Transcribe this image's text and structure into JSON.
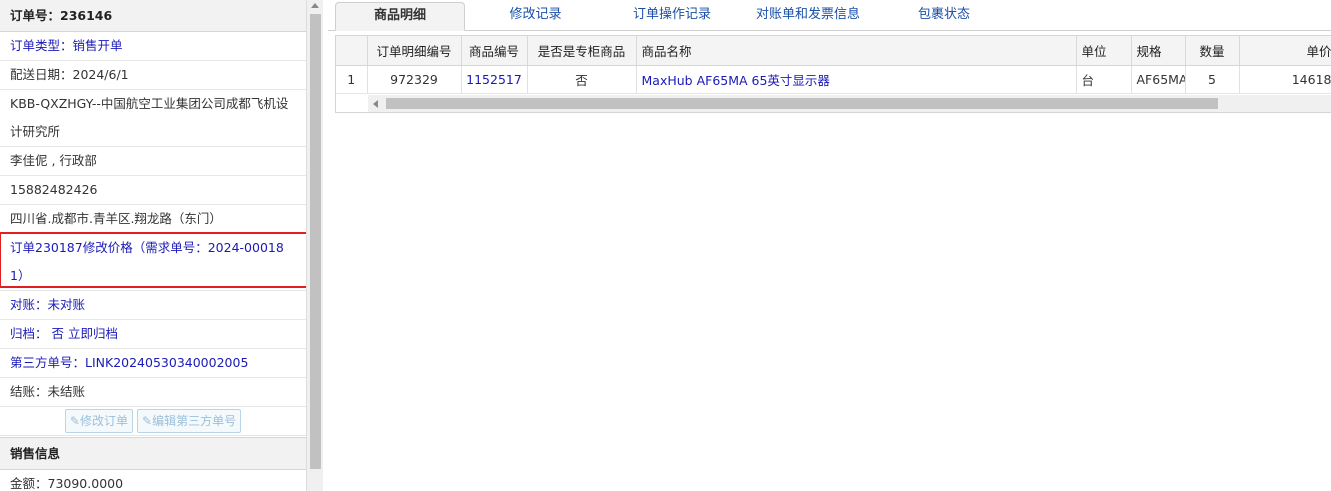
{
  "left": {
    "order_title": "订单号：236146",
    "rows": [
      "订单类型：销售开单",
      "配送日期：2024/6/1",
      "KBB-QXZHGY--中国航空工业集团公司成都飞机设计研究所",
      "李佳伲 , 行政部",
      "15882482426",
      "四川省.成都市.青羊区.翔龙路（东门）",
      "订单230187修改价格（需求单号：2024-000181）",
      "对账：未对账",
      "归档：  否 立即归档",
      "第三方单号：LINK20240530340002005",
      "结账：未结账"
    ],
    "buttons": [
      "修改订单",
      "编辑第三方单号"
    ],
    "sales_title": "销售信息",
    "amount": "金额：73090.0000"
  },
  "tabs": [
    "商品明细",
    "修改记录",
    "订单操作记录",
    "对账单和发票信息",
    "包裹状态"
  ],
  "active_tab": 0,
  "table": {
    "headers": [
      "",
      "订单明细编号",
      "商品编号",
      "是否是专柜商品",
      "商品名称",
      "单位",
      "规格",
      "数量",
      "单价"
    ],
    "rows": [
      [
        "1",
        "972329",
        "1152517",
        "否",
        "MaxHub AF65MA 65英寸显示器",
        "台",
        "AF65MA",
        "5",
        "14618"
      ]
    ]
  },
  "colors": {
    "link": "#1a1ab8",
    "highlight": "#e02020"
  },
  "icons": {
    "edit": "edit-icon",
    "scroll_up": "chevron-up-icon",
    "scroll_left": "chevron-left-icon"
  }
}
